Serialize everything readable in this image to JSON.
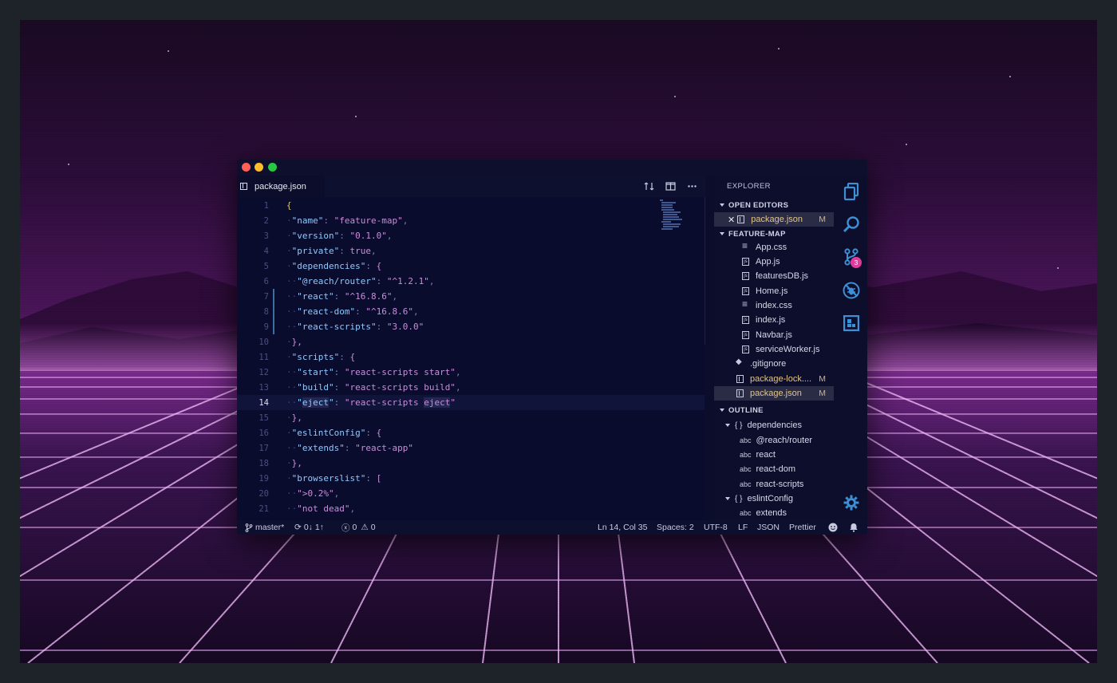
{
  "window": {
    "tab_label": "package.json"
  },
  "editor": {
    "current_line": 14,
    "lines": [
      {
        "n": "1"
      },
      {
        "n": "2"
      },
      {
        "n": "3"
      },
      {
        "n": "4"
      },
      {
        "n": "5"
      },
      {
        "n": "6"
      },
      {
        "n": "7"
      },
      {
        "n": "8"
      },
      {
        "n": "9"
      },
      {
        "n": "10"
      },
      {
        "n": "11"
      },
      {
        "n": "12"
      },
      {
        "n": "13"
      },
      {
        "n": "14"
      },
      {
        "n": "15"
      },
      {
        "n": "16"
      },
      {
        "n": "17"
      },
      {
        "n": "18"
      },
      {
        "n": "19"
      },
      {
        "n": "20"
      },
      {
        "n": "21"
      }
    ],
    "code": {
      "l1": "{",
      "l2_key": "\"name\"",
      "l2_val": "\"feature-map\"",
      "l3_key": "\"version\"",
      "l3_val": "\"0.1.0\"",
      "l4_key": "\"private\"",
      "l4_val": "true",
      "l5_key": "\"dependencies\"",
      "l6_key": "\"@reach/router\"",
      "l6_val": "\"^1.2.1\"",
      "l7_key": "\"react\"",
      "l7_val": "\"^16.8.6\"",
      "l8_key": "\"react-dom\"",
      "l8_val": "\"^16.8.6\"",
      "l9_key": "\"react-scripts\"",
      "l9_val": "\"3.0.0\"",
      "l10": "},",
      "l11_key": "\"scripts\"",
      "l12_key": "\"start\"",
      "l12_val": "\"react-scripts start\"",
      "l13_key": "\"build\"",
      "l13_val": "\"react-scripts build\"",
      "l14_key_a": "\"",
      "l14_key_b": "eject",
      "l14_key_c": "\"",
      "l14_val_a": "\"react-scripts ",
      "l14_val_b": "eject",
      "l14_val_c": "\"",
      "l15": "},",
      "l16_key": "\"eslintConfig\"",
      "l17_key": "\"extends\"",
      "l17_val": "\"react-app\"",
      "l18": "},",
      "l19_key": "\"browserslist\"",
      "l20_val": "\">0.2%\"",
      "l21_val": "\"not dead\""
    }
  },
  "sidebar": {
    "title": "EXPLORER",
    "open_editors_label": "OPEN EDITORS",
    "open_editor_file": "package.json",
    "open_editor_badge": "M",
    "folder_label": "FEATURE-MAP",
    "files": [
      {
        "name": "App.css",
        "icon": "css-file-icon"
      },
      {
        "name": "App.js",
        "icon": "js-file-icon"
      },
      {
        "name": "featuresDB.js",
        "icon": "js-file-icon"
      },
      {
        "name": "Home.js",
        "icon": "js-file-icon"
      },
      {
        "name": "index.css",
        "icon": "css-file-icon"
      },
      {
        "name": "index.js",
        "icon": "js-file-icon"
      },
      {
        "name": "Navbar.js",
        "icon": "js-file-icon"
      },
      {
        "name": "serviceWorker.js",
        "icon": "js-file-icon"
      },
      {
        "name": ".gitignore",
        "icon": "git-file-icon"
      },
      {
        "name": "package-lock....",
        "icon": "json-file-icon",
        "badge": "M"
      },
      {
        "name": "package.json",
        "icon": "json-file-icon",
        "badge": "M"
      }
    ],
    "outline_label": "OUTLINE",
    "outline": [
      {
        "name": "dependencies",
        "kind": "object"
      },
      {
        "name": "@reach/router",
        "kind": "string"
      },
      {
        "name": "react",
        "kind": "string"
      },
      {
        "name": "react-dom",
        "kind": "string"
      },
      {
        "name": "react-scripts",
        "kind": "string"
      },
      {
        "name": "eslintConfig",
        "kind": "object"
      },
      {
        "name": "extends",
        "kind": "string"
      }
    ],
    "outline_object_icon": "{ }",
    "outline_string_icon": "abc"
  },
  "activity_bar": {
    "items": [
      "files-icon",
      "search-icon",
      "source-control-icon",
      "debug-icon",
      "extensions-icon"
    ],
    "source_control_badge": "3",
    "settings": "gear-icon"
  },
  "statusbar": {
    "branch": "master*",
    "sync": "0↓ 1↑",
    "errors": "0",
    "warnings": "0",
    "position": "Ln 14, Col 35",
    "spaces": "Spaces: 2",
    "encoding": "UTF-8",
    "eol": "LF",
    "language": "JSON",
    "formatter": "Prettier"
  },
  "colors": {
    "editor_bg": "#0a0c2d",
    "key": "#8fc9ff",
    "string": "#c88ed9",
    "badge": "#e03a9c",
    "modified": "#e2c48a",
    "activity_icon": "#3d8fd6"
  }
}
